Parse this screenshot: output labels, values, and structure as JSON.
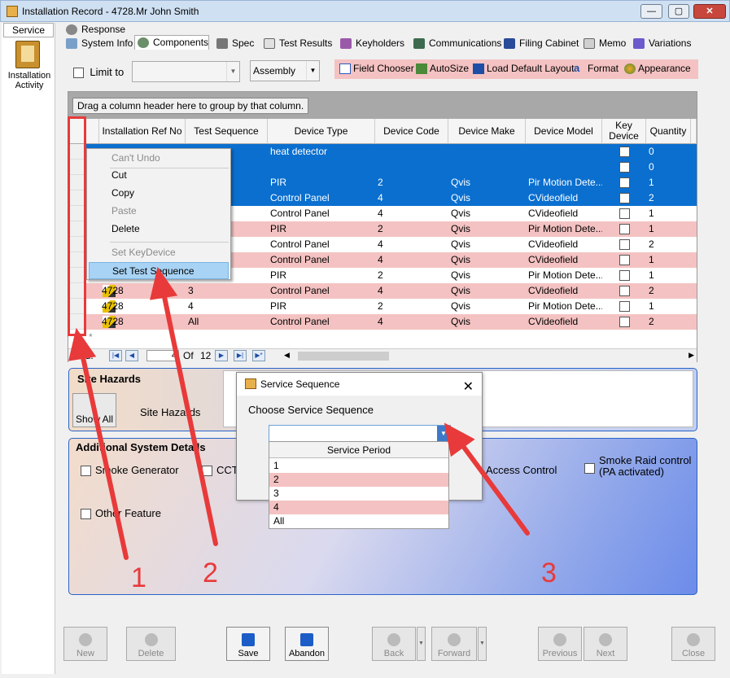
{
  "window": {
    "title": "Installation Record - 4728.Mr John Smith",
    "minimize": "—",
    "maximize": "▢",
    "close": "✕"
  },
  "leftnav": {
    "service_tab": "Service",
    "installation_activity": "Installation Activity"
  },
  "tabs": {
    "response": "Response",
    "system_info": "System Info",
    "components": "Components",
    "spec": "Spec",
    "test_results": "Test Results",
    "keyholders": "Keyholders",
    "communications": "Communications",
    "filing_cabinet": "Filing Cabinet",
    "memo": "Memo",
    "variations": "Variations"
  },
  "toolbar": {
    "limit_to": "Limit to",
    "limit_value": "",
    "group_combo": "Assembly",
    "field_chooser": "Field Chooser",
    "autosize": "AutoSize",
    "load_default_layout": "Load Default Layout",
    "format": "Format",
    "appearance": "Appearance"
  },
  "grid": {
    "group_hint": "Drag a column header here to group by that column.",
    "columns": [
      "Installation Ref No",
      "Test Sequence",
      "Device Type",
      "Device Code",
      "Device Make",
      "Device Model",
      "Key Device",
      "Quantity"
    ],
    "rows": [
      {
        "ref": "",
        "seq": "",
        "type": "heat detector",
        "code": "",
        "make": "",
        "model": "",
        "key": false,
        "qty": "0",
        "style": "sel"
      },
      {
        "ref": "",
        "seq": "",
        "type": "",
        "code": "",
        "make": "",
        "model": "",
        "key": false,
        "qty": "0",
        "style": "sel"
      },
      {
        "ref": "",
        "seq": "",
        "type": "PIR",
        "code": "2",
        "make": "Qvis",
        "model": "Pir Motion Dete...",
        "key": false,
        "qty": "1",
        "style": "sel"
      },
      {
        "ref": "",
        "seq": "",
        "type": "Control Panel",
        "code": "4",
        "make": "Qvis",
        "model": "CVideofield",
        "key": false,
        "qty": "2",
        "style": "sel"
      },
      {
        "ref": "",
        "seq": "",
        "type": "Control Panel",
        "code": "4",
        "make": "Qvis",
        "model": "CVideofield",
        "key": false,
        "qty": "1",
        "style": "white"
      },
      {
        "ref": "",
        "seq": "",
        "type": "PIR",
        "code": "2",
        "make": "Qvis",
        "model": "Pir Motion Dete...",
        "key": false,
        "qty": "1",
        "style": "pink"
      },
      {
        "ref": "",
        "seq": "",
        "type": "Control Panel",
        "code": "4",
        "make": "Qvis",
        "model": "CVideofield",
        "key": false,
        "qty": "2",
        "style": "white"
      },
      {
        "ref": "",
        "seq": "",
        "type": "Control Panel",
        "code": "4",
        "make": "Qvis",
        "model": "CVideofield",
        "key": false,
        "qty": "1",
        "style": "pink"
      },
      {
        "ref": "",
        "seq": "",
        "type": "PIR",
        "code": "2",
        "make": "Qvis",
        "model": "Pir Motion Dete...",
        "key": false,
        "qty": "1",
        "style": "white"
      },
      {
        "ref": "4728",
        "seq": "3",
        "type": "Control Panel",
        "code": "4",
        "make": "Qvis",
        "model": "CVideofield",
        "key": false,
        "qty": "2",
        "style": "pink"
      },
      {
        "ref": "4728",
        "seq": "4",
        "type": "PIR",
        "code": "2",
        "make": "Qvis",
        "model": "Pir Motion Dete...",
        "key": false,
        "qty": "1",
        "style": "white"
      },
      {
        "ref": "4728",
        "seq": "All",
        "type": "Control Panel",
        "code": "4",
        "make": "Qvis",
        "model": "CVideofield",
        "key": false,
        "qty": "2",
        "style": "pink"
      }
    ],
    "new_row_marker": "*",
    "nav_record_label": "ord:",
    "nav_current": "4",
    "nav_of": "Of",
    "nav_total": "12"
  },
  "context_menu": {
    "items": [
      {
        "label": "Can't Undo",
        "disabled": true
      },
      {
        "label": "Cut",
        "disabled": false
      },
      {
        "label": "Copy",
        "disabled": false
      },
      {
        "label": "Paste",
        "disabled": true
      },
      {
        "label": "Delete",
        "disabled": false
      },
      {
        "label": "Set KeyDevice",
        "disabled": true
      },
      {
        "label": "Set Test Sequence",
        "disabled": false,
        "highlighted": true
      }
    ]
  },
  "site_hazards": {
    "title": "Site Hazards",
    "show_all": "Show All",
    "label": "Site Hazards"
  },
  "additional": {
    "title": "Additional System Details",
    "smoke_generator": "Smoke Generator",
    "cctv": "CCTV",
    "access_control": "Access Control",
    "smoke_raid": "Smoke Raid control (PA activated)",
    "other_feature": "Other Feature"
  },
  "dialog": {
    "title": "Service Sequence",
    "close": "✕",
    "prompt": "Choose Service Sequence",
    "value": "",
    "dropdown_header": "Service Period",
    "options": [
      "1",
      "2",
      "3",
      "4",
      "All"
    ]
  },
  "bottom": {
    "new": "New",
    "delete": "Delete",
    "save": "Save",
    "abandon": "Abandon",
    "back": "Back",
    "forward": "Forward",
    "previous": "Previous",
    "next": "Next",
    "close": "Close"
  },
  "annotations": {
    "callout_1": "1",
    "callout_2": "2",
    "callout_3": "3"
  },
  "colors": {
    "selected_row": "#0a6fcf",
    "pink_row": "#f4c2c2",
    "annotation_red": "#e83a3a"
  }
}
